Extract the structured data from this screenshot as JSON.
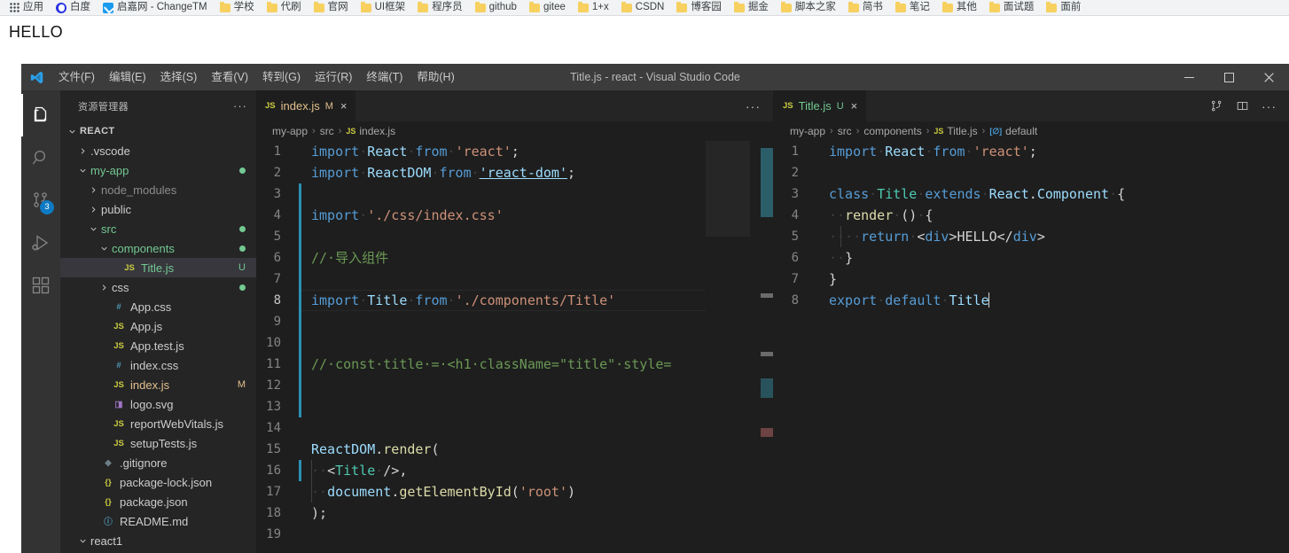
{
  "browser": {
    "bookmarks": [
      {
        "label": "应用",
        "icon": "apps-grid-icon"
      },
      {
        "label": "白度",
        "icon": "baidu-icon"
      },
      {
        "label": "启嘉网 - ChangeTM",
        "icon": "blue-check-icon"
      },
      {
        "label": "学校",
        "icon": "folder-icon"
      },
      {
        "label": "代刷",
        "icon": "folder-icon"
      },
      {
        "label": "官网",
        "icon": "folder-icon"
      },
      {
        "label": "UI框架",
        "icon": "folder-icon"
      },
      {
        "label": "程序员",
        "icon": "folder-icon"
      },
      {
        "label": "github",
        "icon": "folder-icon"
      },
      {
        "label": "gitee",
        "icon": "folder-icon"
      },
      {
        "label": "1+x",
        "icon": "folder-icon"
      },
      {
        "label": "CSDN",
        "icon": "folder-icon"
      },
      {
        "label": "博客园",
        "icon": "folder-icon"
      },
      {
        "label": "掘金",
        "icon": "folder-icon"
      },
      {
        "label": "脚本之家",
        "icon": "folder-icon"
      },
      {
        "label": "简书",
        "icon": "folder-icon"
      },
      {
        "label": "笔记",
        "icon": "folder-icon"
      },
      {
        "label": "其他",
        "icon": "folder-icon"
      },
      {
        "label": "面试题",
        "icon": "folder-icon"
      },
      {
        "label": "面前",
        "icon": "folder-icon"
      }
    ],
    "page_text": "HELLO"
  },
  "vscode": {
    "title": "Title.js - react - Visual Studio Code",
    "menus": [
      "文件(F)",
      "编辑(E)",
      "选择(S)",
      "查看(V)",
      "转到(G)",
      "运行(R)",
      "终端(T)",
      "帮助(H)"
    ],
    "window_controls": {
      "minimize": "minimize-icon",
      "maximize": "maximize-icon",
      "close": "close-icon"
    },
    "activity_bar": [
      {
        "name": "explorer",
        "icon": "files-icon",
        "active": true,
        "badge": ""
      },
      {
        "name": "search",
        "icon": "search-icon",
        "active": false,
        "badge": ""
      },
      {
        "name": "source-control",
        "icon": "source-control-icon",
        "active": false,
        "badge": "3"
      },
      {
        "name": "run-debug",
        "icon": "run-and-debug-icon",
        "active": false,
        "badge": ""
      },
      {
        "name": "extensions",
        "icon": "extensions-icon",
        "active": false,
        "badge": ""
      }
    ],
    "sidebar": {
      "title": "资源管理器",
      "more_actions": "···",
      "tree": [
        {
          "label": "REACT",
          "indent": 0,
          "twisty": "down",
          "icon": "",
          "iconClass": "",
          "labelClass": "c-root",
          "badge": "",
          "dot": ""
        },
        {
          "label": ".vscode",
          "indent": 1,
          "twisty": "right",
          "icon": "",
          "iconClass": "",
          "labelClass": "",
          "badge": "",
          "dot": ""
        },
        {
          "label": "my-app",
          "indent": 1,
          "twisty": "down",
          "icon": "",
          "iconClass": "",
          "labelClass": "c-green",
          "badge": "",
          "dot": "#73c991"
        },
        {
          "label": "node_modules",
          "indent": 2,
          "twisty": "right",
          "icon": "",
          "iconClass": "",
          "labelClass": "c-grey",
          "badge": "",
          "dot": ""
        },
        {
          "label": "public",
          "indent": 2,
          "twisty": "right",
          "icon": "",
          "iconClass": "",
          "labelClass": "",
          "badge": "",
          "dot": ""
        },
        {
          "label": "src",
          "indent": 2,
          "twisty": "down",
          "icon": "",
          "iconClass": "",
          "labelClass": "c-green",
          "badge": "",
          "dot": "#73c991"
        },
        {
          "label": "components",
          "indent": 3,
          "twisty": "down",
          "icon": "",
          "iconClass": "",
          "labelClass": "c-green",
          "badge": "",
          "dot": "#73c991"
        },
        {
          "label": "Title.js",
          "indent": 4,
          "twisty": "none",
          "icon": "JS",
          "iconClass": "i-js",
          "labelClass": "c-green",
          "badge": "U",
          "dot": "",
          "selected": true
        },
        {
          "label": "css",
          "indent": 3,
          "twisty": "right",
          "icon": "",
          "iconClass": "",
          "labelClass": "",
          "badge": "",
          "dot": "#73c991"
        },
        {
          "label": "App.css",
          "indent": 3,
          "twisty": "none",
          "icon": "#",
          "iconClass": "i-css",
          "labelClass": "",
          "badge": "",
          "dot": ""
        },
        {
          "label": "App.js",
          "indent": 3,
          "twisty": "none",
          "icon": "JS",
          "iconClass": "i-js",
          "labelClass": "",
          "badge": "",
          "dot": ""
        },
        {
          "label": "App.test.js",
          "indent": 3,
          "twisty": "none",
          "icon": "JS",
          "iconClass": "i-js",
          "labelClass": "",
          "badge": "",
          "dot": ""
        },
        {
          "label": "index.css",
          "indent": 3,
          "twisty": "none",
          "icon": "#",
          "iconClass": "i-css",
          "labelClass": "",
          "badge": "",
          "dot": ""
        },
        {
          "label": "index.js",
          "indent": 3,
          "twisty": "none",
          "icon": "JS",
          "iconClass": "i-js",
          "labelClass": "c-orange",
          "badge": "M",
          "dot": ""
        },
        {
          "label": "logo.svg",
          "indent": 3,
          "twisty": "none",
          "icon": "◨",
          "iconClass": "i-svg",
          "labelClass": "",
          "badge": "",
          "dot": ""
        },
        {
          "label": "reportWebVitals.js",
          "indent": 3,
          "twisty": "none",
          "icon": "JS",
          "iconClass": "i-js",
          "labelClass": "",
          "badge": "",
          "dot": ""
        },
        {
          "label": "setupTests.js",
          "indent": 3,
          "twisty": "none",
          "icon": "JS",
          "iconClass": "i-js",
          "labelClass": "",
          "badge": "",
          "dot": ""
        },
        {
          "label": ".gitignore",
          "indent": 2,
          "twisty": "none",
          "icon": "◆",
          "iconClass": "i-git",
          "labelClass": "",
          "badge": "",
          "dot": ""
        },
        {
          "label": "package-lock.json",
          "indent": 2,
          "twisty": "none",
          "icon": "{}",
          "iconClass": "i-json",
          "labelClass": "",
          "badge": "",
          "dot": ""
        },
        {
          "label": "package.json",
          "indent": 2,
          "twisty": "none",
          "icon": "{}",
          "iconClass": "i-json",
          "labelClass": "",
          "badge": "",
          "dot": ""
        },
        {
          "label": "README.md",
          "indent": 2,
          "twisty": "none",
          "icon": "ⓘ",
          "iconClass": "i-md",
          "labelClass": "",
          "badge": "",
          "dot": ""
        },
        {
          "label": "react1",
          "indent": 1,
          "twisty": "down",
          "icon": "",
          "iconClass": "",
          "labelClass": "",
          "badge": "",
          "dot": ""
        }
      ]
    },
    "editor_left": {
      "tab": {
        "icon": "JS",
        "name": "index.js",
        "badge": "M",
        "close": "×",
        "state": "modified"
      },
      "more_actions": "···",
      "breadcrumb": [
        "my-app",
        "src",
        "index.js"
      ],
      "breadcrumb_icon": "JS",
      "lines": [
        {
          "n": 1,
          "html": "<span class=\"t-kw\">import</span><span class=\"t-ws\">·</span><span class=\"t-id\">React</span><span class=\"t-ws\">·</span><span class=\"t-kw\">from</span><span class=\"t-ws\">·</span><span class=\"t-str\">'react'</span><span class=\"t-pun\">;</span>"
        },
        {
          "n": 2,
          "html": "<span class=\"t-kw\">import</span><span class=\"t-ws\">·</span><span class=\"t-id\">ReactDOM</span><span class=\"t-ws\">·</span><span class=\"t-kw\">from</span><span class=\"t-ws\">·</span><span class=\"t-link t-str\">'react-dom'</span><span class=\"t-pun\">;</span>"
        },
        {
          "n": 3,
          "html": ""
        },
        {
          "n": 4,
          "html": "<span class=\"t-kw\">import</span><span class=\"t-ws\">·</span><span class=\"t-str\">'./css/index.css'</span>"
        },
        {
          "n": 5,
          "html": ""
        },
        {
          "n": 6,
          "html": "<span class=\"t-cmt\">//·导入组件</span>"
        },
        {
          "n": 7,
          "html": ""
        },
        {
          "n": 8,
          "html": "<span class=\"t-kw\">import</span><span class=\"t-ws\">·</span><span class=\"t-id\">Title</span><span class=\"t-ws\">·</span><span class=\"t-kw\">from</span><span class=\"t-ws\">·</span><span class=\"t-str\">'./components/Title'</span>",
          "current": true
        },
        {
          "n": 9,
          "html": ""
        },
        {
          "n": 10,
          "html": ""
        },
        {
          "n": 11,
          "html": "<span class=\"t-cmt\">//·const·title·=·&lt;h1·className=\"title\"·style=</span>"
        },
        {
          "n": 12,
          "html": ""
        },
        {
          "n": 13,
          "html": ""
        },
        {
          "n": 14,
          "html": ""
        },
        {
          "n": 15,
          "html": "<span class=\"t-id\">ReactDOM</span><span class=\"t-pun\">.</span><span class=\"t-fn\">render</span><span class=\"t-pun\">(</span>"
        },
        {
          "n": 16,
          "html": "<span class=\"t-ws\">··</span><span class=\"t-pun\">&lt;</span><span class=\"t-cls\">Title</span><span class=\"t-ws\">·</span><span class=\"t-pun\">/&gt;,</span>"
        },
        {
          "n": 17,
          "html": "<span class=\"t-ws\">··</span><span class=\"t-id\">document</span><span class=\"t-pun\">.</span><span class=\"t-fn\">getElementById</span><span class=\"t-pun\">(</span><span class=\"t-str\">'root'</span><span class=\"t-pun\">)</span>"
        },
        {
          "n": 18,
          "html": "<span class=\"t-pun\">);</span>"
        },
        {
          "n": 19,
          "html": ""
        }
      ]
    },
    "editor_right": {
      "tab": {
        "icon": "JS",
        "name": "Title.js",
        "badge": "U",
        "close": "×",
        "state": "untracked"
      },
      "actions": [
        "compare-changes-icon",
        "split-editor-icon",
        "more-actions-icon"
      ],
      "breadcrumb": [
        "my-app",
        "src",
        "components",
        "Title.js",
        "default"
      ],
      "breadcrumb_icon": "JS",
      "breadcrumb_symbol_icon": "[∅]",
      "lines": [
        {
          "n": 1,
          "html": "<span class=\"t-kw\">import</span><span class=\"t-ws\">·</span><span class=\"t-id\">React</span><span class=\"t-ws\">·</span><span class=\"t-kw\">from</span><span class=\"t-ws\">·</span><span class=\"t-str\">'react'</span><span class=\"t-pun\">;</span>"
        },
        {
          "n": 2,
          "html": ""
        },
        {
          "n": 3,
          "html": "<span class=\"t-kw\">class</span><span class=\"t-ws\">·</span><span class=\"t-cls\">Title</span><span class=\"t-ws\">·</span><span class=\"t-kw\">extends</span><span class=\"t-ws\">·</span><span class=\"t-id\">React</span><span class=\"t-pun\">.</span><span class=\"t-id\">Component</span><span class=\"t-ws\">·</span><span class=\"t-pun\">{</span>"
        },
        {
          "n": 4,
          "html": "<span class=\"t-ws\">··</span><span class=\"t-fn\">render</span><span class=\"t-ws\">·</span><span class=\"t-pun\">()</span><span class=\"t-ws\">·</span><span class=\"t-pun\">{</span>"
        },
        {
          "n": 5,
          "html": "<span class=\"t-ws\">··</span><span class=\"t-ws\">··</span><span class=\"t-kw\">return</span><span class=\"t-ws\">·</span><span class=\"t-pun\">&lt;</span><span class=\"t-tag\">div</span><span class=\"t-pun\">&gt;</span><span class=\"t-pun\">HELLO</span><span class=\"t-pun\">&lt;/</span><span class=\"t-tag\">div</span><span class=\"t-pun\">&gt;</span>"
        },
        {
          "n": 6,
          "html": "<span class=\"t-ws\">··</span><span class=\"t-pun\">}</span>"
        },
        {
          "n": 7,
          "html": "<span class=\"t-pun\">}</span>"
        },
        {
          "n": 8,
          "html": "<span class=\"t-kw\">export</span><span class=\"t-ws\">·</span><span class=\"t-kw\">default</span><span class=\"t-ws\">·</span><span class=\"t-id\">Title</span><span class=\"cursor-bar\"></span>"
        }
      ]
    }
  },
  "colors": {
    "accent_blue": "#0e7ac4",
    "editor_bg": "#1e1e1e",
    "sidebar_bg": "#252526",
    "titlebar_bg": "#3c3c3c",
    "activity_bg": "#333333",
    "git_untracked": "#73c991",
    "git_modified": "#e2c08d",
    "bookmark_bar_bg": "#f1f3f4"
  }
}
